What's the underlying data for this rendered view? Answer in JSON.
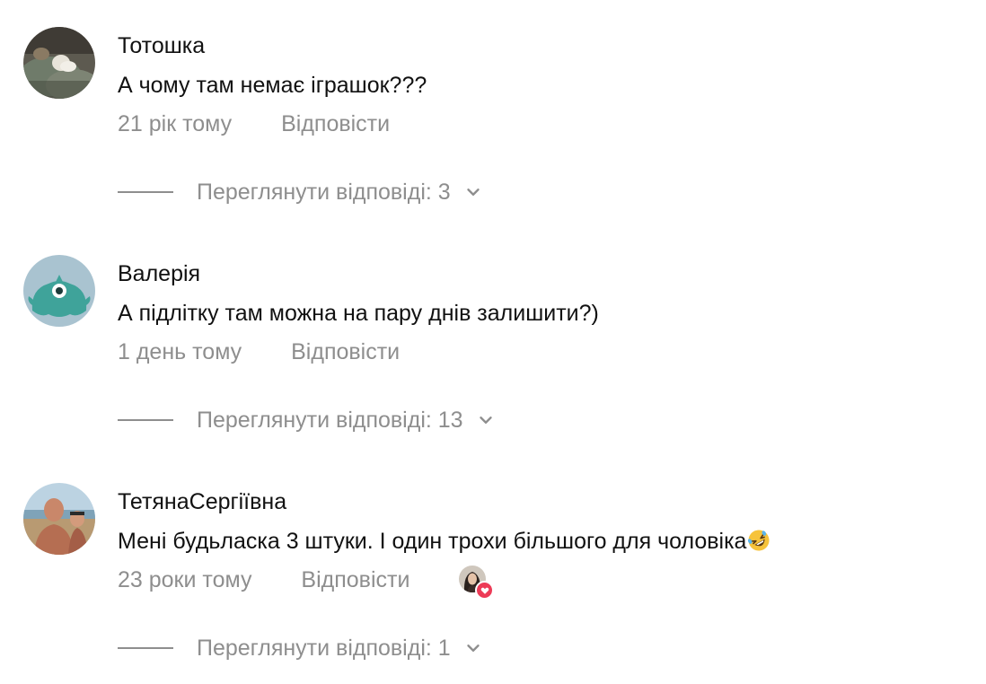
{
  "comments": [
    {
      "username": "Тотошка",
      "text": "А чому там немає іграшок???",
      "time": "21 рік тому",
      "reply_label": "Відповісти",
      "view_replies_label": "Переглянути відповіді: 3",
      "avatar_icon": "photo-avatar-icon"
    },
    {
      "username": "Валерія",
      "text": "А підлітку там можна на пару днів залишити?)",
      "time": "1 день тому",
      "reply_label": "Відповісти",
      "view_replies_label": "Переглянути відповіді: 13",
      "avatar_icon": "monster-avatar-icon"
    },
    {
      "username": "ТетянаСергіївна",
      "text": "Мені будьласка 3 штуки. І один трохи більшого для чоловіка",
      "emoji": "rolling-on-floor-laughing-emoji",
      "time": "23 роки тому",
      "reply_label": "Відповісти",
      "liked_by_author": true,
      "view_replies_label": "Переглянути відповіді: 1",
      "avatar_icon": "photo-avatar-icon"
    }
  ],
  "colors": {
    "text_primary": "#111111",
    "text_secondary": "#8e8e8e",
    "like_badge": "#ed3b57",
    "monster_avatar_bg": "#a9c3d0",
    "monster_avatar_body": "#3fa39a"
  },
  "icons": {
    "chevron": "chevron-down-icon",
    "like_badge": "heart-icon"
  }
}
